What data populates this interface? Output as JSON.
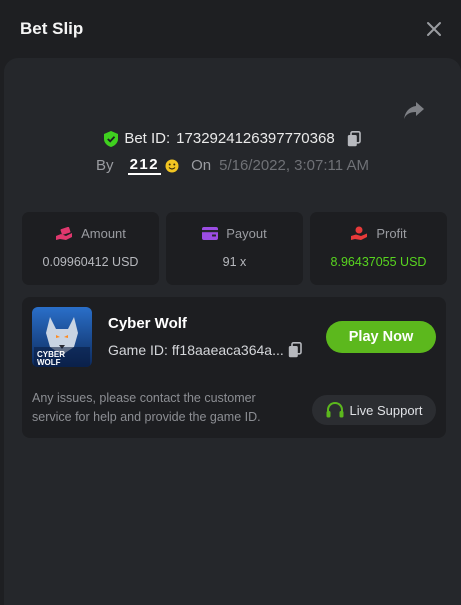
{
  "header": {
    "title": "Bet Slip"
  },
  "bet": {
    "id_label": "Bet ID:",
    "id_value": "1732924126397770368",
    "by_label": "By",
    "username": "212",
    "on_label": "On",
    "datetime": "5/16/2022, 3:07:11 AM"
  },
  "stats": [
    {
      "label": "Amount",
      "value": "0.09960412 USD",
      "icon": "money-hand-icon"
    },
    {
      "label": "Payout",
      "value": "91 x",
      "icon": "wallet-icon"
    },
    {
      "label": "Profit",
      "value": "8.96437055 USD",
      "icon": "profit-hand-icon"
    }
  ],
  "game": {
    "name": "Cyber Wolf",
    "id_label": "Game ID:",
    "id_value": "ff18aaeaca364a...",
    "thumb_text": "CYBER WOLF",
    "play_label": "Play Now",
    "note": "Any issues, please contact the customer service for help and provide the game ID.",
    "support_label": "Live Support"
  },
  "colors": {
    "accent_green": "#5cb81d",
    "profit_green": "#58d51f",
    "shield_green": "#3fd01f",
    "amount_pink": "#e0386e",
    "payout_purple": "#9b4de3",
    "profit_red": "#e83a3a"
  }
}
